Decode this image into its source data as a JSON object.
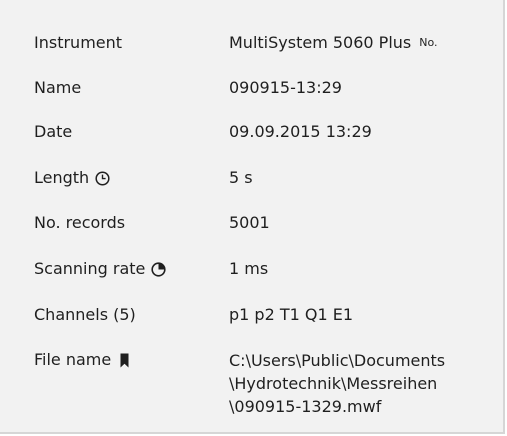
{
  "rows": [
    {
      "label": "Instrument",
      "value": "MultiSystem 5060 Plus",
      "suffix": "No."
    },
    {
      "label": "Name",
      "value": "090915-13:29"
    },
    {
      "label": "Date",
      "value": "09.09.2015 13:29"
    },
    {
      "label": "Length",
      "value": "5 s",
      "icon": "clock-icon"
    },
    {
      "label": "No. records",
      "value": "5001"
    },
    {
      "label": "Scanning rate",
      "value": "1 ms",
      "icon": "pie-clock-icon"
    },
    {
      "label": "Channels (5)",
      "value": "p1 p2 T1 Q1 E1"
    },
    {
      "label": "File name",
      "value_lines": [
        "C:\\Users\\Public\\Documents",
        "\\Hydrotechnik\\Messreihen",
        "\\090915-1329.mwf"
      ],
      "icon": "bookmark-icon"
    }
  ]
}
